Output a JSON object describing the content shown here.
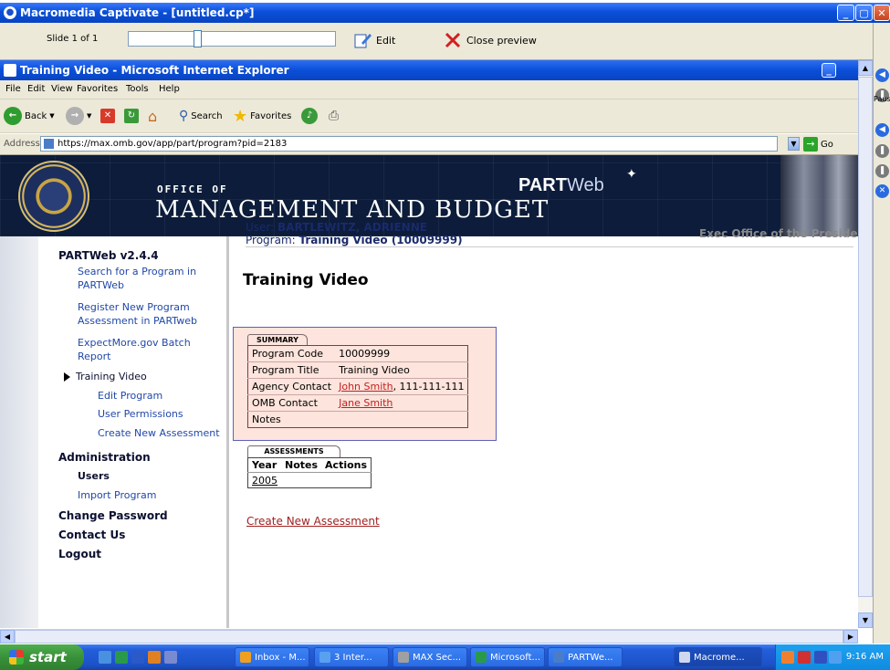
{
  "captivate": {
    "title": "Macromedia Captivate - [untitled.cp*]",
    "slide_label": "Slide 1 of 1",
    "edit_label": "Edit",
    "close_preview_label": "Close preview",
    "pause_label": "Paus"
  },
  "ie": {
    "title": "Training Video - Microsoft Internet Explorer",
    "menu": [
      "File",
      "Edit",
      "View",
      "Favorites",
      "Tools",
      "Help"
    ],
    "toolbar": {
      "back": "Back",
      "search": "Search",
      "favorites": "Favorites"
    },
    "address_label": "Address",
    "address_value": "https://max.omb.gov/app/part/program?pid=2183",
    "go_label": "Go"
  },
  "banner": {
    "office_of": "OFFICE OF",
    "title": "MANAGEMENT AND BUDGET",
    "partweb_bold": "PART",
    "partweb_rest": "Web"
  },
  "nav": {
    "version": "PARTWeb v2.4.4",
    "search_program": "Search for a Program in PARTWeb",
    "register_program": "Register New Program Assessment in PARTweb",
    "expectmore": "ExpectMore.gov Batch Report",
    "current_program": "Training Video",
    "edit_program": "Edit Program",
    "user_permissions": "User Permissions",
    "create_assessment": "Create New Assessment",
    "administration": "Administration",
    "users": "Users",
    "import_program": "Import Program",
    "change_password": "Change Password",
    "contact_us": "Contact Us",
    "logout": "Logout"
  },
  "header": {
    "user_label": "User:",
    "user_name": "BARTLEWITZ, ADRIENNE",
    "program_label": "Program:",
    "program_name": "Training Video (10009999)",
    "exec_office": "Exec Office of the Presiden"
  },
  "main": {
    "page_title": "Training Video",
    "summary_tab": "SUMMARY",
    "summary": {
      "program_code_label": "Program Code",
      "program_code": "10009999",
      "program_title_label": "Program Title",
      "program_title": "Training Video",
      "agency_contact_label": "Agency Contact",
      "agency_contact_name": "John Smith",
      "agency_contact_phone": ", 111-111-111",
      "omb_contact_label": "OMB Contact",
      "omb_contact_name": "Jane Smith",
      "notes_label": "Notes"
    },
    "assessments_tab": "ASSESSMENTS",
    "assessments_headers": [
      "Year",
      "Notes",
      "Actions"
    ],
    "assessments_rows": [
      {
        "year": "2005"
      }
    ],
    "create_new_assessment": "Create New Assessment"
  },
  "taskbar": {
    "start": "start",
    "tasks": [
      "Inbox - M...",
      "3 Inter...",
      "MAX Sec...",
      "Microsoft...",
      "PARTWe...",
      "Macrome..."
    ],
    "clock": "9:16 AM"
  }
}
